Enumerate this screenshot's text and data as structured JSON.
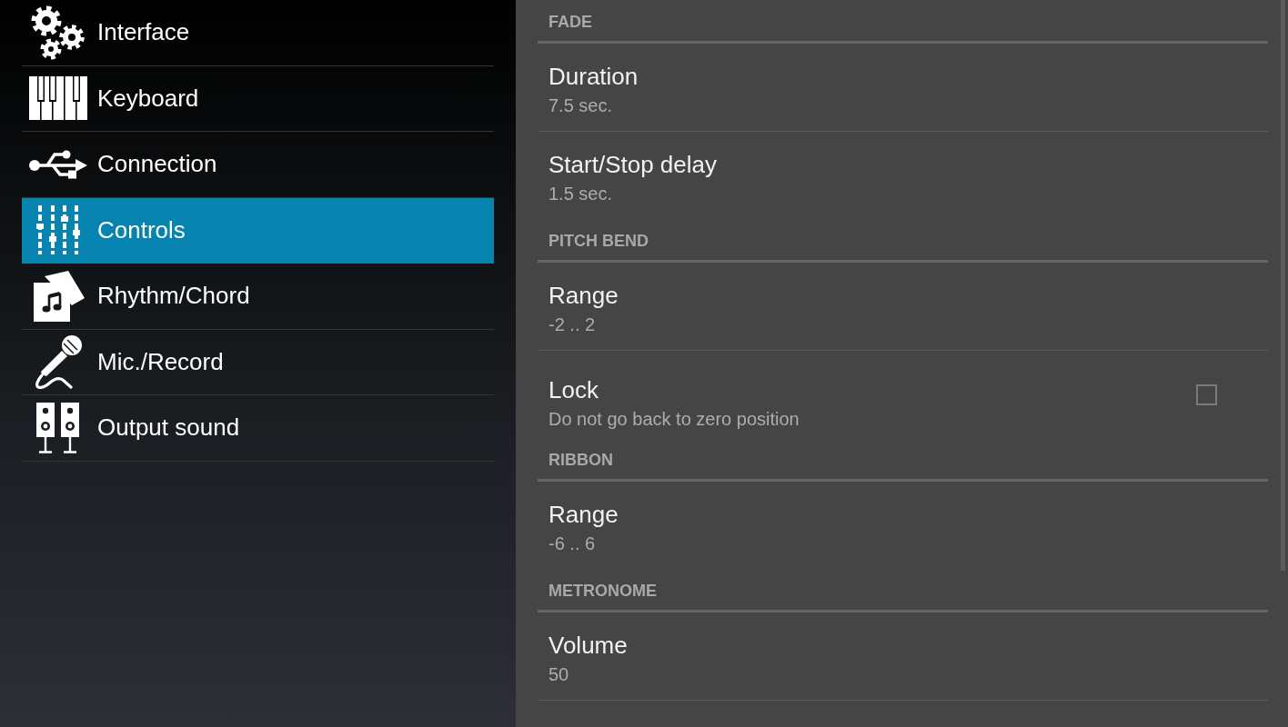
{
  "sidebar": {
    "items": [
      {
        "label": "Interface",
        "selected": false
      },
      {
        "label": "Keyboard",
        "selected": false
      },
      {
        "label": "Connection",
        "selected": false
      },
      {
        "label": "Controls",
        "selected": true
      },
      {
        "label": "Rhythm/Chord",
        "selected": false
      },
      {
        "label": "Mic./Record",
        "selected": false
      },
      {
        "label": "Output sound",
        "selected": false
      }
    ]
  },
  "settings": {
    "sections": [
      {
        "heading": "FADE",
        "items": [
          {
            "kind": "text",
            "title": "Duration",
            "summary": "7.5 sec."
          },
          {
            "kind": "text",
            "title": "Start/Stop delay",
            "summary": "1.5 sec."
          }
        ]
      },
      {
        "heading": "PITCH BEND",
        "items": [
          {
            "kind": "text",
            "title": "Range",
            "summary": "-2 .. 2"
          },
          {
            "kind": "checkbox",
            "title": "Lock",
            "summary": "Do not go back to zero position",
            "checked": false
          }
        ]
      },
      {
        "heading": "RIBBON",
        "items": [
          {
            "kind": "text",
            "title": "Range",
            "summary": "-6 .. 6"
          }
        ]
      },
      {
        "heading": "METRONOME",
        "items": [
          {
            "kind": "text",
            "title": "Volume",
            "summary": "50"
          }
        ]
      }
    ]
  }
}
